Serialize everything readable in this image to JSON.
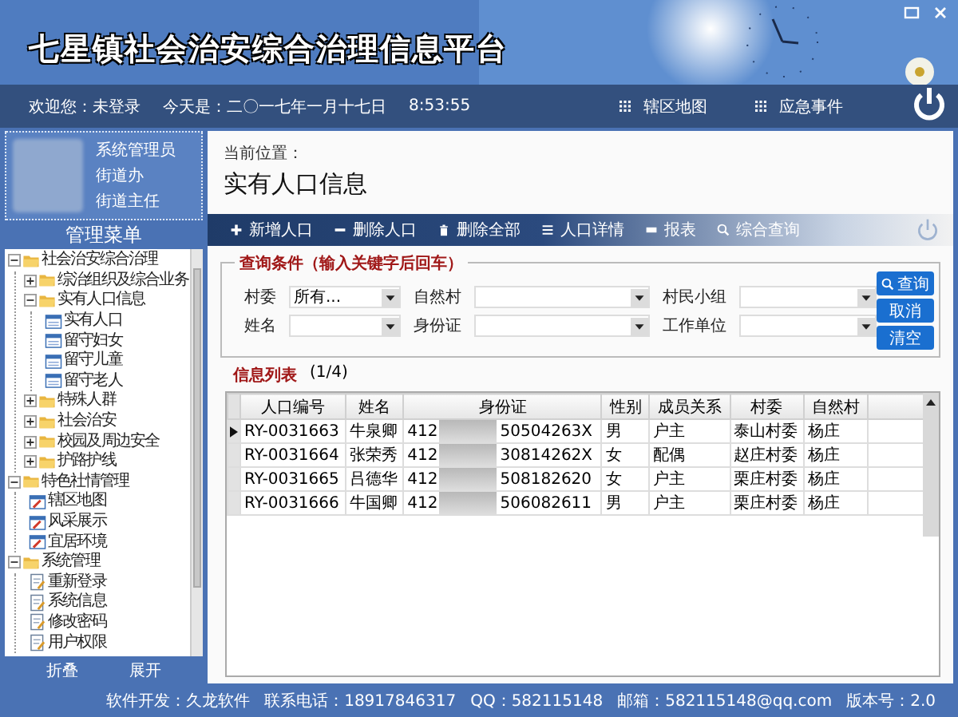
{
  "header": {
    "title": "七星镇社会治安综合治理信息平台",
    "welcome": "欢迎您：未登录",
    "date": "今天是：二〇一七年一月十七日",
    "time": "8:53:55",
    "nav": [
      {
        "label": "辖区地图"
      },
      {
        "label": "应急事件"
      }
    ]
  },
  "profile": {
    "lines": [
      "系统管理员",
      "街道办",
      "街道主任"
    ]
  },
  "menu": {
    "title": "管理菜单",
    "tree": [
      {
        "label": "社会治安综合治理",
        "kind": "folder",
        "expanded": true,
        "children": [
          {
            "label": "综治组织及综合业务",
            "kind": "folder",
            "expanded": false
          },
          {
            "label": "实有人口信息",
            "kind": "folder",
            "expanded": true,
            "children": [
              {
                "label": "实有人口",
                "kind": "table"
              },
              {
                "label": "留守妇女",
                "kind": "table"
              },
              {
                "label": "留守儿童",
                "kind": "table"
              },
              {
                "label": "留守老人",
                "kind": "table"
              }
            ]
          },
          {
            "label": "特殊人群",
            "kind": "folder",
            "expanded": false
          },
          {
            "label": "社会治安",
            "kind": "folder",
            "expanded": false
          },
          {
            "label": "校园及周边安全",
            "kind": "folder",
            "expanded": false
          },
          {
            "label": "护路护线",
            "kind": "folder",
            "expanded": false
          }
        ]
      },
      {
        "label": "特色社情管理",
        "kind": "folder",
        "expanded": true,
        "children": [
          {
            "label": "辖区地图",
            "kind": "map"
          },
          {
            "label": "风采展示",
            "kind": "map"
          },
          {
            "label": "宜居环境",
            "kind": "map"
          }
        ]
      },
      {
        "label": "系统管理",
        "kind": "folder",
        "expanded": true,
        "children": [
          {
            "label": "重新登录",
            "kind": "edit"
          },
          {
            "label": "系统信息",
            "kind": "edit"
          },
          {
            "label": "修改密码",
            "kind": "edit"
          },
          {
            "label": "用户权限",
            "kind": "edit"
          }
        ]
      }
    ],
    "buttons": [
      "折叠",
      "展开"
    ]
  },
  "content": {
    "location_label": "当前位置：",
    "page_title": "实有人口信息",
    "toolbar": [
      {
        "label": "新增人口",
        "kind": "plus"
      },
      {
        "label": "删除人口",
        "kind": "minus"
      },
      {
        "label": "删除全部",
        "kind": "trash"
      },
      {
        "label": "人口详情",
        "kind": "lines"
      },
      {
        "label": "报表",
        "kind": "bar"
      },
      {
        "label": "综合查询",
        "kind": "search"
      }
    ],
    "query": {
      "legend": "查询条件（输入关键字后回车）",
      "fields": [
        {
          "label": "村委",
          "value": "所有..."
        },
        {
          "label": "自然村"
        },
        {
          "label": "村民小组"
        },
        {
          "label": "姓名"
        },
        {
          "label": "身份证"
        },
        {
          "label": "工作单位"
        }
      ],
      "buttons": [
        "查询",
        "取消",
        "清空"
      ]
    },
    "list_title": "信息列表",
    "list_count": "(1/4)",
    "table": {
      "columns": [
        "人口编号",
        "姓名",
        "身份证",
        "性别",
        "成员关系",
        "村委",
        "自然村"
      ],
      "rows": [
        {
          "selected": true,
          "cells": [
            "RY-0031663",
            "牛泉卿",
            {
              "prefix": "412",
              "suffix": "50504263X"
            },
            "男",
            "户主",
            "泰山村委",
            "杨庄"
          ]
        },
        {
          "selected": false,
          "cells": [
            "RY-0031664",
            "张荣秀",
            {
              "prefix": "412",
              "suffix": "30814262X"
            },
            "女",
            "配偶",
            "赵庄村委",
            "杨庄"
          ]
        },
        {
          "selected": false,
          "cells": [
            "RY-0031665",
            "吕德华",
            {
              "prefix": "412",
              "suffix": "508182620"
            },
            "女",
            "户主",
            "栗庄村委",
            "杨庄"
          ]
        },
        {
          "selected": false,
          "cells": [
            "RY-0031666",
            "牛国卿",
            {
              "prefix": "412",
              "suffix": "506082611"
            },
            "男",
            "户主",
            "栗庄村委",
            "杨庄"
          ]
        }
      ]
    }
  },
  "status_bar": [
    "软件开发：久龙软件",
    "联系电话：18917846317",
    "QQ：582115148",
    "邮箱：582115148@qq.com",
    "版本号：2.0"
  ]
}
